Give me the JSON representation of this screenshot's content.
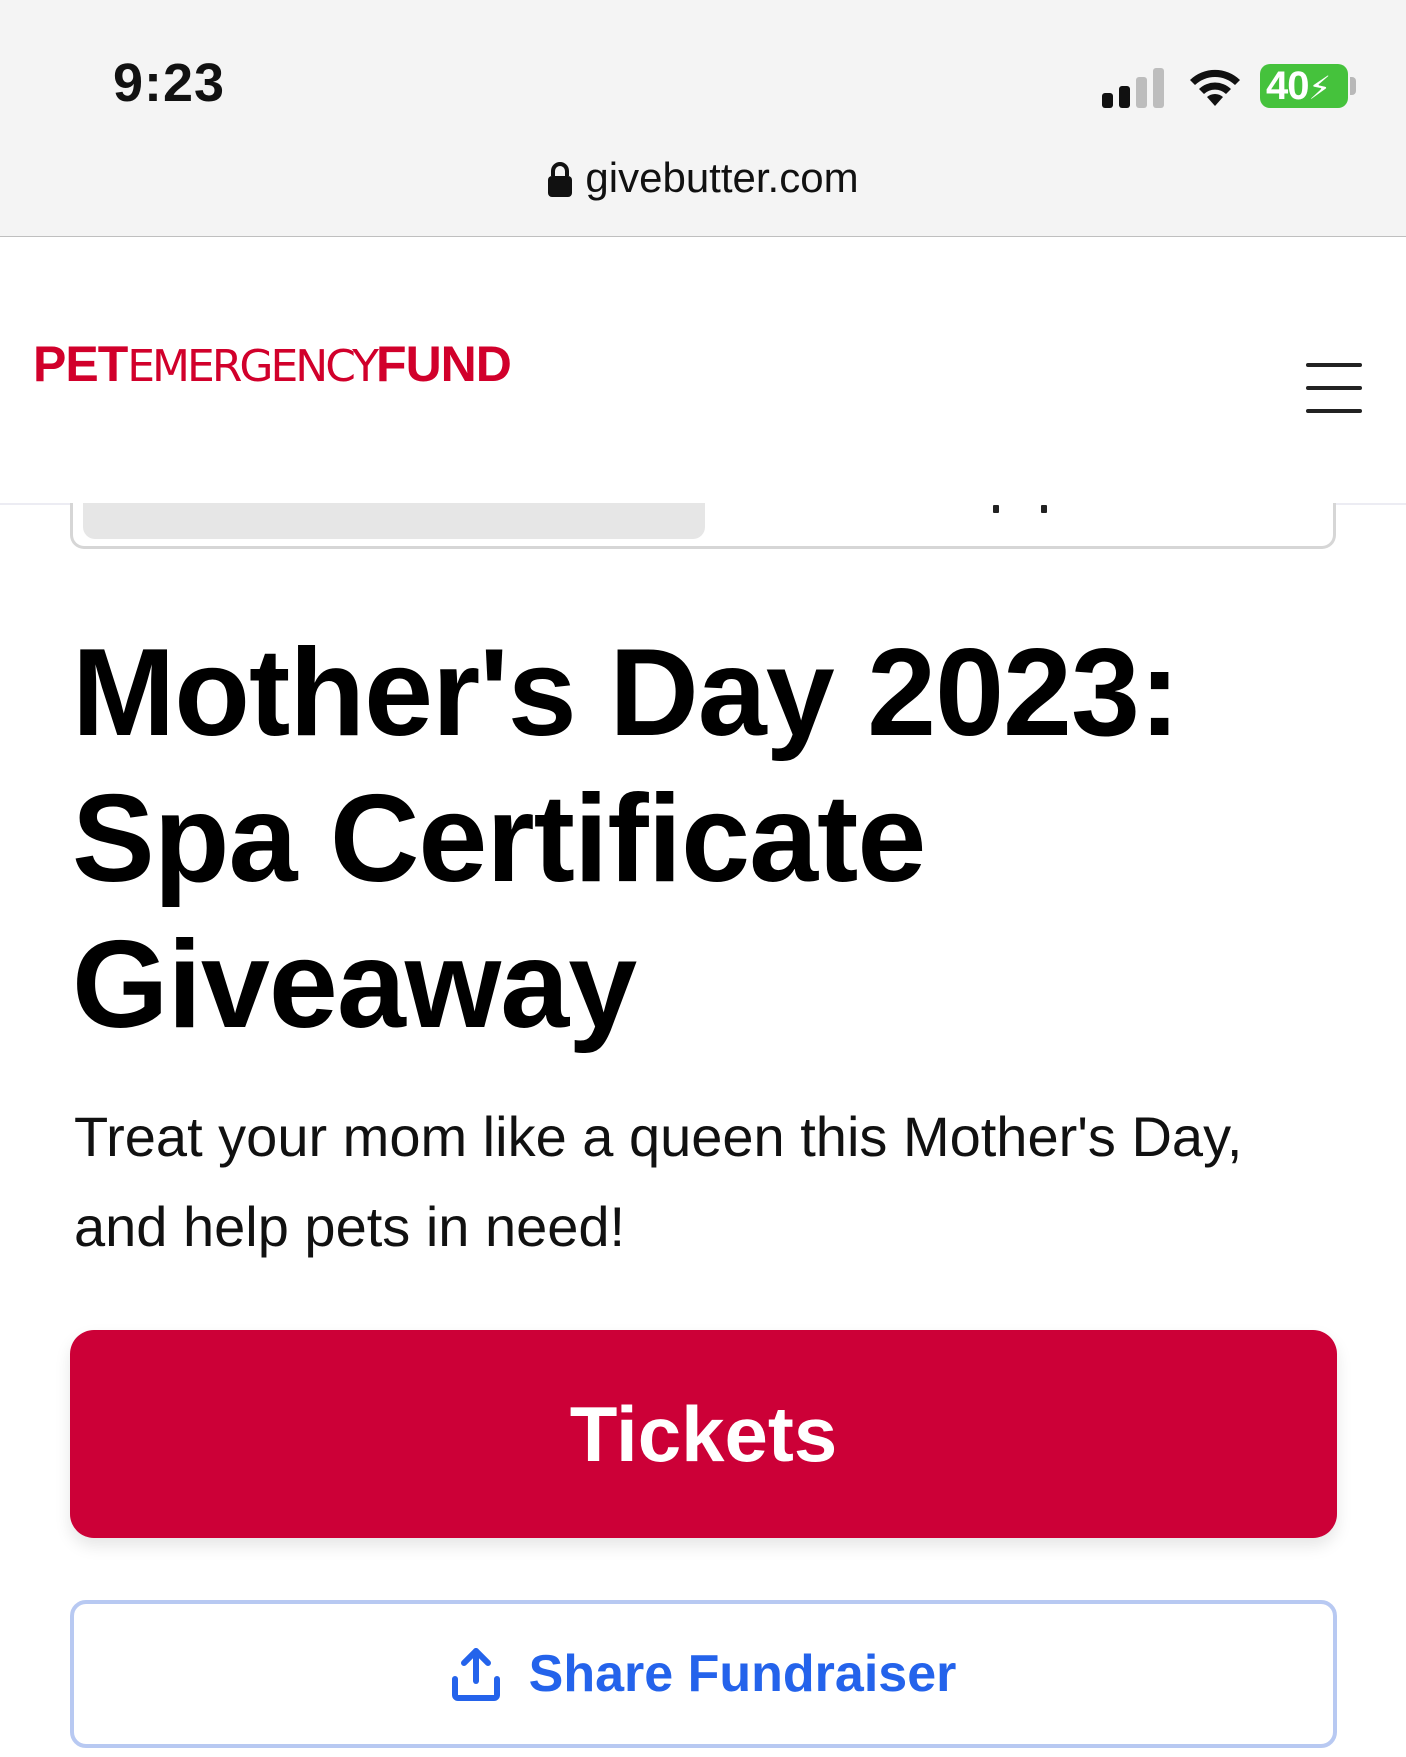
{
  "status_bar": {
    "time": "9:23",
    "battery": "40",
    "signal_icon": "cellular-signal-icon",
    "wifi_icon": "wifi-icon",
    "battery_color": "#45c23c"
  },
  "browser": {
    "url": "givebutter.com",
    "lock_icon": "lock-icon"
  },
  "header": {
    "logo_part1": "PET",
    "logo_part2": "EMERGENCY",
    "logo_part3": "FUND",
    "logo_color": "#d1002b",
    "menu_icon": "hamburger-menu-icon"
  },
  "main": {
    "title": "Mother's Day 2023: Spa Certificate Giveaway",
    "subtitle": "Treat your mom like a queen this Mother's Day, and help pets in need!",
    "tickets_label": "Tickets",
    "share_label": "Share Fundraiser",
    "share_icon": "share-upload-icon",
    "accent_color": "#cc0037",
    "link_color": "#2463eb"
  }
}
